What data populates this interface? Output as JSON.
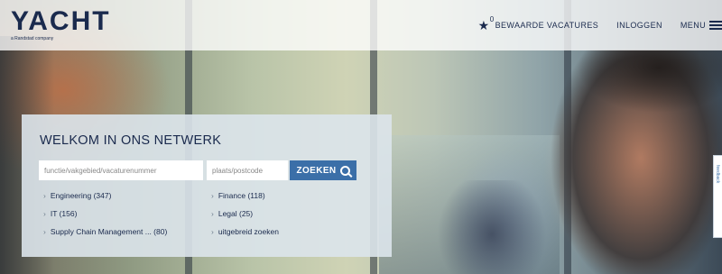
{
  "header": {
    "logo": "YACHT",
    "logo_subtitle": "a Randstad company",
    "saved_jobs_label": "BEWAARDE VACATURES",
    "saved_jobs_count": "0",
    "login_label": "INLOGGEN",
    "menu_label": "MENU"
  },
  "search": {
    "title": "WELKOM IN ONS NETWERK",
    "job_placeholder": "functie/vakgebied/vacaturenummer",
    "place_placeholder": "plaats/postcode",
    "button_label": "ZOEKEN"
  },
  "categories": [
    {
      "label": "Engineering (347)"
    },
    {
      "label": "IT (156)"
    },
    {
      "label": "Supply Chain Management ...  (80)"
    },
    {
      "label": "Finance (118)"
    },
    {
      "label": "Legal (25)"
    },
    {
      "label": "uitgebreid zoeken"
    }
  ],
  "side_tab": {
    "label": "feedback"
  },
  "icons": {
    "star": "star-icon",
    "menu": "hamburger-menu-icon",
    "search": "search-icon",
    "chevron": "chevron-right-icon"
  },
  "colors": {
    "brand_navy": "#1a2a4d",
    "button_blue": "#3b6fa8"
  }
}
